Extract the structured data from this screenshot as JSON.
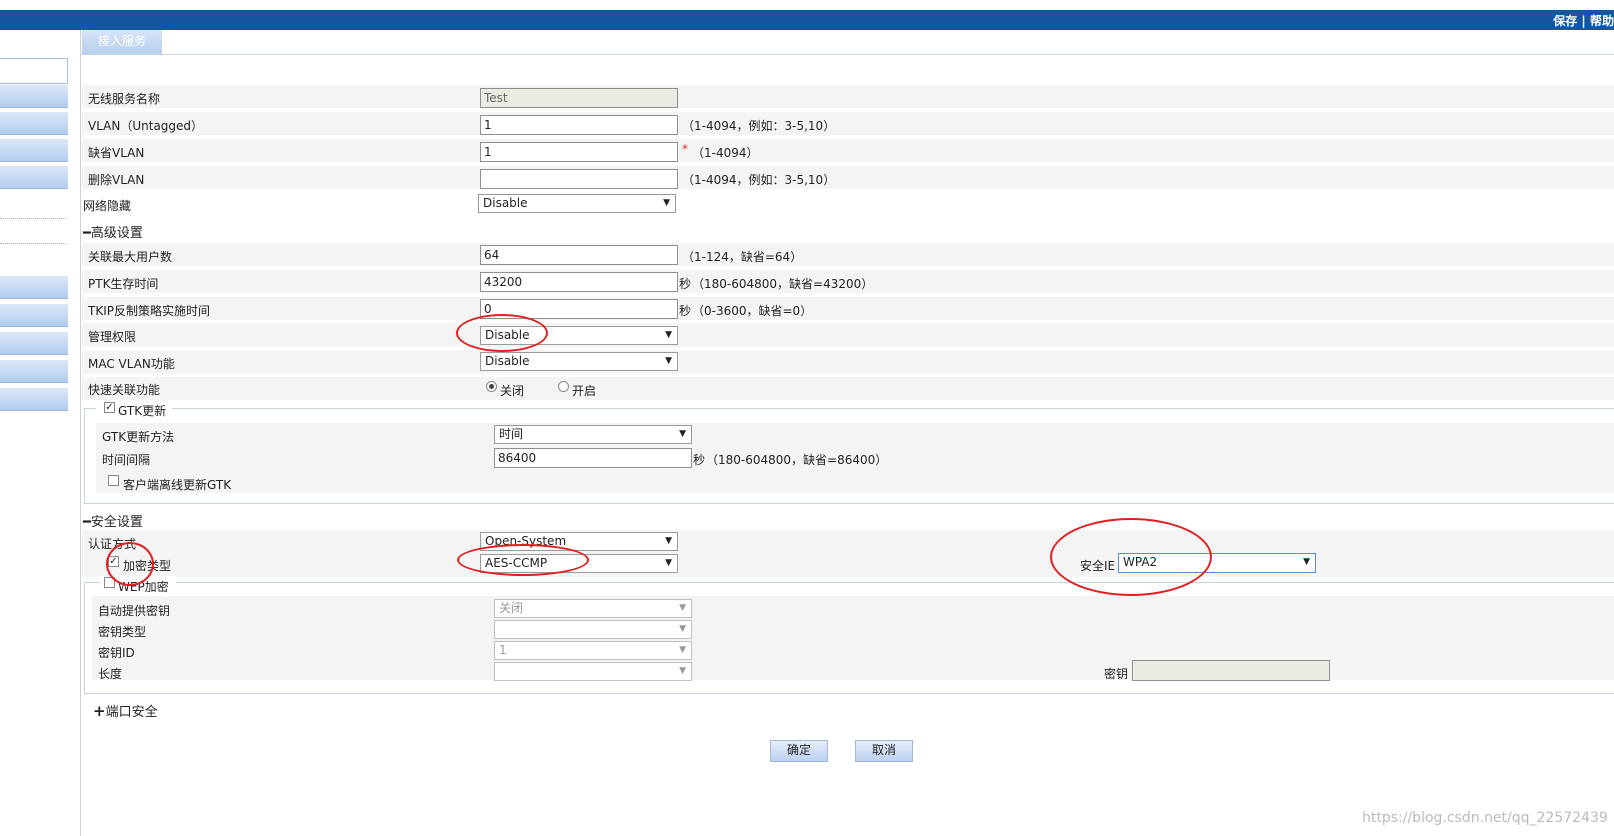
{
  "topbar": {
    "links": "保存 | 帮助"
  },
  "tab": {
    "label": "接入服务"
  },
  "basic": {
    "service_name": {
      "label": "无线服务名称",
      "value": "Test"
    },
    "vlan_untagged": {
      "label": "VLAN（Untagged）",
      "value": "1",
      "hint": "（1-4094，例如：3-5,10）"
    },
    "default_vlan": {
      "label": "缺省VLAN",
      "value": "1",
      "star": "*",
      "hint": "（1-4094）"
    },
    "delete_vlan": {
      "label": "删除VLAN",
      "value": "",
      "hint": "（1-4094，例如：3-5,10）"
    },
    "hide_network": {
      "label": "网络隐藏",
      "value": "Disable"
    }
  },
  "advanced": {
    "section_label": "高级设置",
    "max_users": {
      "label": "关联最大用户数",
      "value": "64",
      "hint": "（1-124，缺省=64）"
    },
    "ptk_lifetime": {
      "label": "PTK生存时间",
      "value": "43200",
      "unit": "秒",
      "hint": "（180-604800，缺省=43200）"
    },
    "tkip_time": {
      "label": "TKIP反制策略实施时间",
      "value": "0",
      "unit": "秒",
      "hint": "（0-3600，缺省=0）"
    },
    "mgmt_priv": {
      "label": "管理权限",
      "value": "Disable"
    },
    "mac_vlan": {
      "label": "MAC VLAN功能",
      "value": "Disable"
    },
    "fast_assoc": {
      "label": "快速关联功能",
      "off": "关闭",
      "on": "开启"
    },
    "gtk": {
      "label": "GTK更新",
      "method": {
        "label": "GTK更新方法",
        "value": "时间"
      },
      "interval": {
        "label": "时间间隔",
        "value": "86400",
        "unit": "秒",
        "hint": "（180-604800，缺省=86400）"
      },
      "offline": {
        "label": "客户端离线更新GTK"
      }
    }
  },
  "security": {
    "section_label": "安全设置",
    "auth": {
      "label": "认证方式",
      "value": "Open-System"
    },
    "cipher": {
      "label": "加密类型",
      "value": "AES-CCMP"
    },
    "security_ie": {
      "label": "安全IE",
      "value": "WPA2"
    },
    "wep": {
      "label": "WEP加密",
      "auto_key": {
        "label": "自动提供密钥",
        "value": "关闭"
      },
      "key_type": {
        "label": "密钥类型",
        "value": ""
      },
      "key_id": {
        "label": "密钥ID",
        "value": "1"
      },
      "length": {
        "label": "长度",
        "value": ""
      },
      "key": {
        "label": "密钥",
        "value": ""
      }
    }
  },
  "port_security": {
    "label": "端口安全"
  },
  "buttons": {
    "ok": "确定",
    "cancel": "取消"
  },
  "watermark": "https://blog.csdn.net/qq_22572439",
  "colors": {
    "topbar": "#1556a0",
    "annotation": "#e02020"
  }
}
